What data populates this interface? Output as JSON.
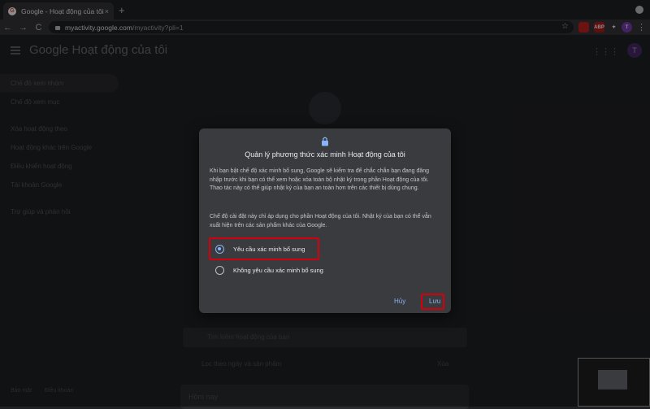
{
  "browser": {
    "tab_title": "Google - Hoạt động của tôi",
    "tab_close": "×",
    "new_tab": "+",
    "url_host": "myactivity.google.com",
    "url_path": "/myactivity?pli=1",
    "star": "☆",
    "back": "←",
    "forward": "→",
    "reload": "C",
    "menu": "⋮",
    "extensions": [
      {
        "label": "",
        "color": "#c5221f"
      },
      {
        "label": "ABP",
        "color": "#b01c1c"
      },
      {
        "label": "✦",
        "color": "#35363a"
      },
      {
        "label": "T",
        "color": "#7b3fb5"
      }
    ]
  },
  "app": {
    "title": "Google Hoạt động của tôi",
    "avatar_letter": "T",
    "sidebar": [
      "Chế độ xem nhóm",
      "Chế độ xem mục",
      "Xóa hoạt động theo",
      "Hoạt động khác trên Google",
      "Điều khiển hoạt động",
      "Tài khoản Google",
      "Trợ giúp và phản hồi"
    ],
    "search_placeholder": "Tìm kiếm hoạt động của bạn",
    "filter_label": "Lọc theo ngày và sản phẩm",
    "delete_label": "Xóa",
    "today": "Hôm nay",
    "footer_privacy": "Bảo mật",
    "footer_terms": "Điều khoản"
  },
  "dialog": {
    "title": "Quản lý phương thức xác minh Hoạt động của tôi",
    "para1": "Khi bạn bật chế độ xác minh bổ sung, Google sẽ kiểm tra để chắc chắn bạn đang đăng nhập trước khi bạn có thể xem hoặc xóa toàn bộ nhật ký trong phần Hoạt động của tôi. Thao tác này có thể giúp nhật ký của bạn an toàn hơn trên các thiết bị dùng chung.",
    "para2": "Chế độ cài đặt này chỉ áp dụng cho phần Hoạt động của tôi. Nhật ký của bạn có thể vẫn xuất hiện trên các sản phẩm khác của Google.",
    "option_on": "Yêu cầu xác minh bổ sung",
    "option_off": "Không yêu cầu xác minh bổ sung",
    "selected": "option_on",
    "cancel": "Hủy",
    "save": "Lưu",
    "highlight_color": "#d4000c",
    "accent": "#8ab4f8"
  }
}
